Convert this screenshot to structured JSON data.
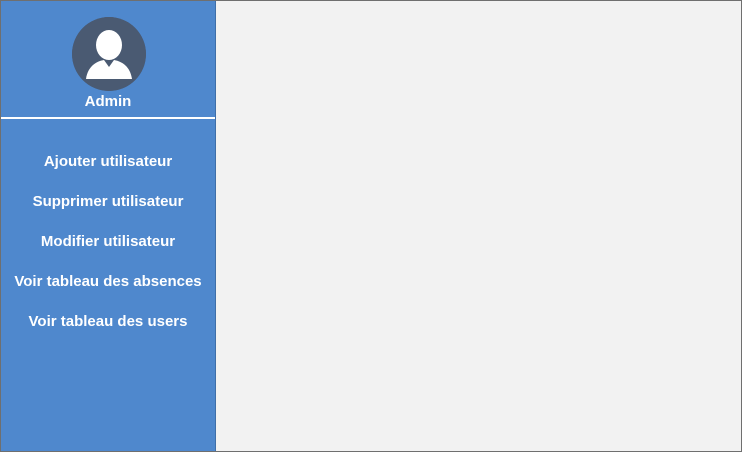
{
  "sidebar": {
    "user": {
      "name": "Admin",
      "avatar_icon": "user-silhouette-icon"
    },
    "menu": [
      {
        "label": "Ajouter utilisateur"
      },
      {
        "label": "Supprimer utilisateur"
      },
      {
        "label": "Modifier utilisateur"
      },
      {
        "label": "Voir tableau des absences"
      },
      {
        "label": "Voir tableau des users"
      }
    ]
  },
  "colors": {
    "sidebar_bg": "#4f88cd",
    "content_bg": "#f2f2f2",
    "avatar_bg": "#4a5a72",
    "text": "#ffffff"
  }
}
